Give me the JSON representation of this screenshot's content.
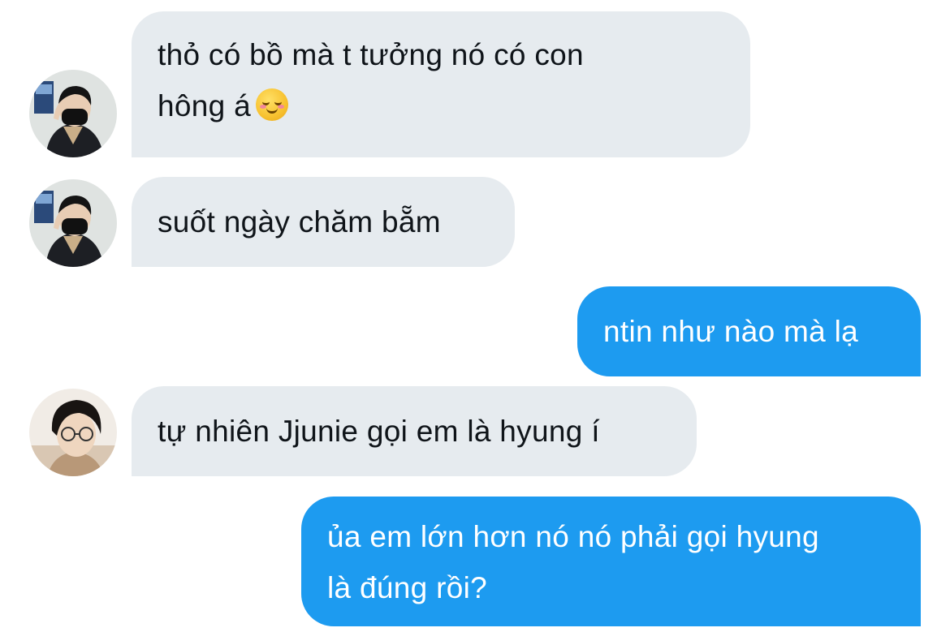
{
  "messages": [
    {
      "direction": "incoming",
      "avatar_icon": "user-avatar-masked",
      "lines": [
        "thỏ có bồ mà t tưởng nó có con",
        "hông á"
      ],
      "emoji": "smiling-face-emoji"
    },
    {
      "direction": "incoming",
      "avatar_icon": "user-avatar-masked",
      "lines": [
        "suốt ngày chăm bẵm"
      ]
    },
    {
      "direction": "outgoing",
      "lines": [
        "ntin như nào mà lạ"
      ]
    },
    {
      "direction": "incoming",
      "avatar_icon": "user-avatar-glasses",
      "lines": [
        "tự nhiên Jjunie gọi em là hyung í"
      ]
    },
    {
      "direction": "outgoing",
      "lines": [
        "ủa em lớn hơn nó nó phải gọi hyung",
        "là đúng rồi?"
      ]
    }
  ],
  "colors": {
    "incoming_bubble": "#e6ebef",
    "outgoing_bubble": "#1d9bf0",
    "incoming_text": "#0f1419",
    "outgoing_text": "#ffffff",
    "background": "#ffffff"
  }
}
